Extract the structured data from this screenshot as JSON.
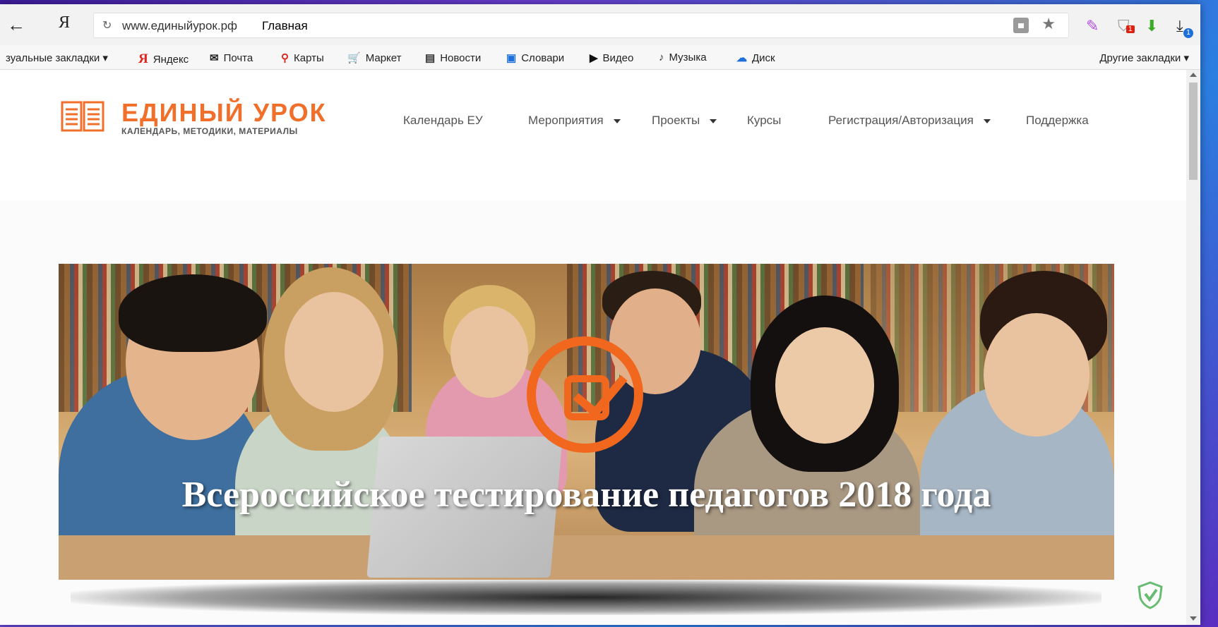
{
  "browser": {
    "address_short": "Я",
    "url": "www.единыйурок.рф",
    "page_title": "Главная",
    "extensions": {
      "shield_badge": "1",
      "download_badge": "1"
    }
  },
  "bookmarks": {
    "items": [
      {
        "icon": "visual-bookmarks",
        "label": "зуальные закладки ▾"
      },
      {
        "icon": "yandex-icon",
        "label": "Яндекс"
      },
      {
        "icon": "mail-icon",
        "label": "Почта"
      },
      {
        "icon": "map-pin-icon",
        "label": "Карты"
      },
      {
        "icon": "cart-icon",
        "label": "Маркет"
      },
      {
        "icon": "news-icon",
        "label": "Новости"
      },
      {
        "icon": "dictionary-icon",
        "label": "Словари"
      },
      {
        "icon": "video-icon",
        "label": "Видео"
      },
      {
        "icon": "music-icon",
        "label": "Музыка"
      },
      {
        "icon": "disk-icon",
        "label": "Диск"
      }
    ],
    "other": "Другие закладки ▾"
  },
  "site": {
    "logo_title": "ЕДИНЫЙ УРОК",
    "logo_subtitle": "КАЛЕНДАРЬ, МЕТОДИКИ, МАТЕРИАЛЫ",
    "nav": [
      {
        "label": "Календарь ЕУ",
        "dropdown": false
      },
      {
        "label": "Мероприятия",
        "dropdown": true
      },
      {
        "label": "Проекты",
        "dropdown": true
      },
      {
        "label": "Курсы",
        "dropdown": false
      },
      {
        "label": "Регистрация/Авторизация",
        "dropdown": true
      },
      {
        "label": "Поддержка",
        "dropdown": false
      }
    ],
    "hero_title": "Всероссийское тестирование педагогов 2018 года"
  },
  "colors": {
    "brand_orange": "#f06f2a",
    "adguard_green": "#68bc71"
  }
}
